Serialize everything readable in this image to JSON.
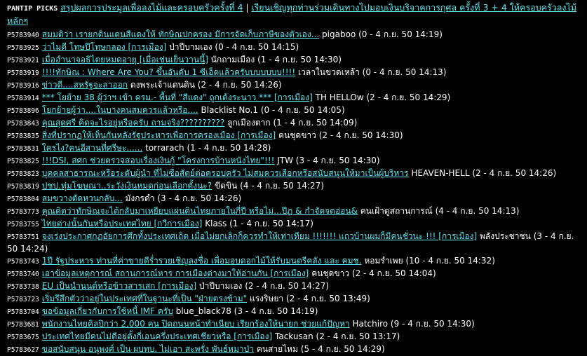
{
  "header": {
    "label": "PANTIP PICKS",
    "link1": "สรุปผลการประมูลเพื่อลงไม้และครอบครัวครั้งที่ 4",
    "sep": "|",
    "link2": "เรียนเชิญทุกท่านร่วมเดินทางไปมอบเงินบริจาคการกุศล ครั้งที่ 3 + 4 ให้ครอบครัวลงไม้หลักๆ"
  },
  "topics": [
    {
      "id": "P5783940",
      "title": "สมมติว่า เรายกดินแดนสีแดงให้ ทักษิณปกครอง มีการจัดเก็บภาษีของตัวเอง...",
      "author": "pigaboo",
      "meta": "(0 - 4 ก.ย. 50 14:19)"
    },
    {
      "id": "P5783925",
      "title": "ว่าไมดี โทษปีโทษกลอง [การเมือง]",
      "author": "ป่าปีบามเอง",
      "meta": "(0 - 4 ก.ย. 50 14:15)"
    },
    {
      "id": "P5783921",
      "title": "เมื่ออำนาจอธิไตยหมดอายุ [เมื่อเช่นเย็นวานนี้]",
      "author": "นักถามเมือง",
      "meta": "(1 - 4 ก.ย. 50 14:30)"
    },
    {
      "id": "P5783919",
      "title": "!!!!ทักษิณ : Where Are You? ขึ้นอันดับ 1 ซีเอ็ดแล้วครับบบบบบบ!!!!",
      "author": "เวลาในขวดเหล้า",
      "meta": "(0 - 4 ก.ย. 50 14:13)"
    },
    {
      "id": "P5783916",
      "title": "ข่าวดี....สหรัฐจะลาออก",
      "author": "ดงพระเจ้าแดนดิน",
      "meta": "(2 - 4 ก.ย. 50 14:26)"
    },
    {
      "id": "P5783914",
      "title": "*** โยย้าย 38 ผู้ว่าฯ เข้า ครม.- พื้นที่ \"สีแดง\" ถูกเด้งระนาว *** [การเมือง]",
      "author": "TH HELLOw",
      "meta": "(2 - 4 ก.ย. 50 14:29)"
    },
    {
      "id": "P5783896",
      "title": "โยกย้ายผู้ว่า....ในบางคนสมควรแล้วหรือ....",
      "author": "Blacklist No.1",
      "meta": "(0 - 4 ก.ย. 50 14:05)"
    },
    {
      "id": "P5783843",
      "title": "คุณสุดศรี คิดจะไรอยู่หรือครับ ถามจริง??????????",
      "author": "ลูกเมืองตาก",
      "meta": "(1 - 4 ก.ย. 50 14:09)"
    },
    {
      "id": "P5783835",
      "title": "สิ่งที่ปรากฏให้เห็นกันหลังรัฐประหารเพื่อการครองเมือง [การเมือง]",
      "author": "คนชุดขาว",
      "meta": "(2 - 4 ก.ย. 50 14:30)"
    },
    {
      "id": "P5783831",
      "title": "ใครไง?คนอีสานที่ศรีษะ......",
      "author": "torrarach",
      "meta": "(1 - 4 ก.ย. 50 14:28)"
    },
    {
      "id": "P5783825",
      "title": "!!!DSI, สศก ช่วยตรวจสอบเรื่องเงินกู้ \"โครงการบ้านหนังไทย\"!!!",
      "author": "JTW",
      "meta": "(3 - 4 ก.ย. 50 14:30)"
    },
    {
      "id": "P5783823",
      "title": "บุคคลสาธารณะหรือระดับผู้นำ ที่ไม่ซื่อสัตย์ต่อครอบครัว ไม่สมควรเลือกหรือสนับสนุนให้มาเป็นผู้บริหาร",
      "author": "HEAVEN-HELL",
      "meta": "(2 - 4 ก.ย. 50 14:26)"
    },
    {
      "id": "P5783819",
      "title": "ปชป.ทุ่มโฆษณา..ระวังเงินหมดก่อนเลือกตั้งนะ?",
      "author": "ขีดขิน",
      "meta": "(4 - 4 ก.ย. 50 14:27)"
    },
    {
      "id": "P5783804",
      "title": "ลมขวางตัดหวนกลับ...",
      "author": "มังกรดำ",
      "meta": "(3 - 4 ก.ย. 50 14:26)"
    },
    {
      "id": "P5783773",
      "title": "คุณคิดว่าทักษิณจะได้กลับมาเหยียบแผ่นดินไทยภายในกี่ปี หรือไม่...ปีฏ & กำจัดจดอ่อน&",
      "author": "คนเฝ้าดูสถานการณ์",
      "meta": "(4 - 4 ก.ย. 50 14:13)"
    },
    {
      "id": "P5783755",
      "title": "ไทยต่างนั้นกันหรือประเทศไทย [กวีการเมือง]",
      "author": "Klass",
      "meta": "(1 - 4 ก.ย. 50 14:17)"
    },
    {
      "id": "P5783751",
      "title": "จงเร่งประกาศกฏอัยการศึกทั้งประเทศเถิด เมื่อไม่ยกเลิกก็ควรทำให้เท่าเทียม !!!!!!! แถวบ้านผมก็มีคนชั่วนะ !!! [การเมือง]",
      "author": "พลังประชาชน",
      "meta": "(3 - 4 ก.ย. 50 14:24)"
    },
    {
      "id": "P5783743",
      "title": "1ปี รัฐประหาร ท่านที่ค่าขายดีร่ำรวยเชิญลงชื่อ เพื่อมอบดอกไม้ให้รับมนตรีคลัง และ คมช.",
      "author": "หอมรำเพย",
      "meta": "(10 - 4 ก.ย. 50 14:32)"
    },
    {
      "id": "P5783740",
      "title": "เอาข้อมูลเหตุการณ์ สถานการณ์หาร การเมืองต่างมาให้อ่านกัน [การเมือง]",
      "author": "คนชุดขาว",
      "meta": "(2 - 4 ก.ย. 50 14:04)"
    },
    {
      "id": "P5783738",
      "title": "EU เป็นนำนนต์หรือข้าวสารเสก [การเมือง]",
      "author": "ป่าปีบามเอง",
      "meta": "(2 - 4 ก.ย. 50 14:27)"
    },
    {
      "id": "P5783723",
      "title": "เริ่มรึสึกตัวว่าอยู่ในประเทศที่ในฐานะที่เป็น \"ฝ่ายตรงข้าม\"",
      "author": "แรงริษยา",
      "meta": "(2 - 4 ก.ย. 50 13:49)"
    },
    {
      "id": "P5783704",
      "title": "ขอข้อมูลเกี่ยวกับการใช้หนี้ IMF ครับ",
      "author": "blue_black78",
      "meta": "(3 - 4 ก.ย. 50 14:19)"
    },
    {
      "id": "P5783681",
      "title": "พนักงานไทยคิลปิกว่า 2,000 คน ปิดถนนหน้าทำเนียบ เรียกร้องให้นายก ช่วยแก้ปัญหา",
      "author": "Hatchiro",
      "meta": "(9 - 4 ก.ย. 50 14:30)"
    },
    {
      "id": "P5783675",
      "title": "ประเทศไทยมีคนไม่ดีอยู่ตั้งกี่เอนครึ่งประเทศเชียวหรือ [การเมือง]",
      "author": "Tackusan",
      "meta": "(2 - 4 ก.ย. 50 13:17)"
    },
    {
      "id": "P5783627",
      "title": "ขอสนับสนุน อนุพงศ์ เป็น ผบทบ. ไม่เอา สะพรั่ง พันธ์หมาป่า",
      "author": "คนสายไหม",
      "meta": "(5 - 4 ก.ย. 50 14:29)"
    }
  ]
}
